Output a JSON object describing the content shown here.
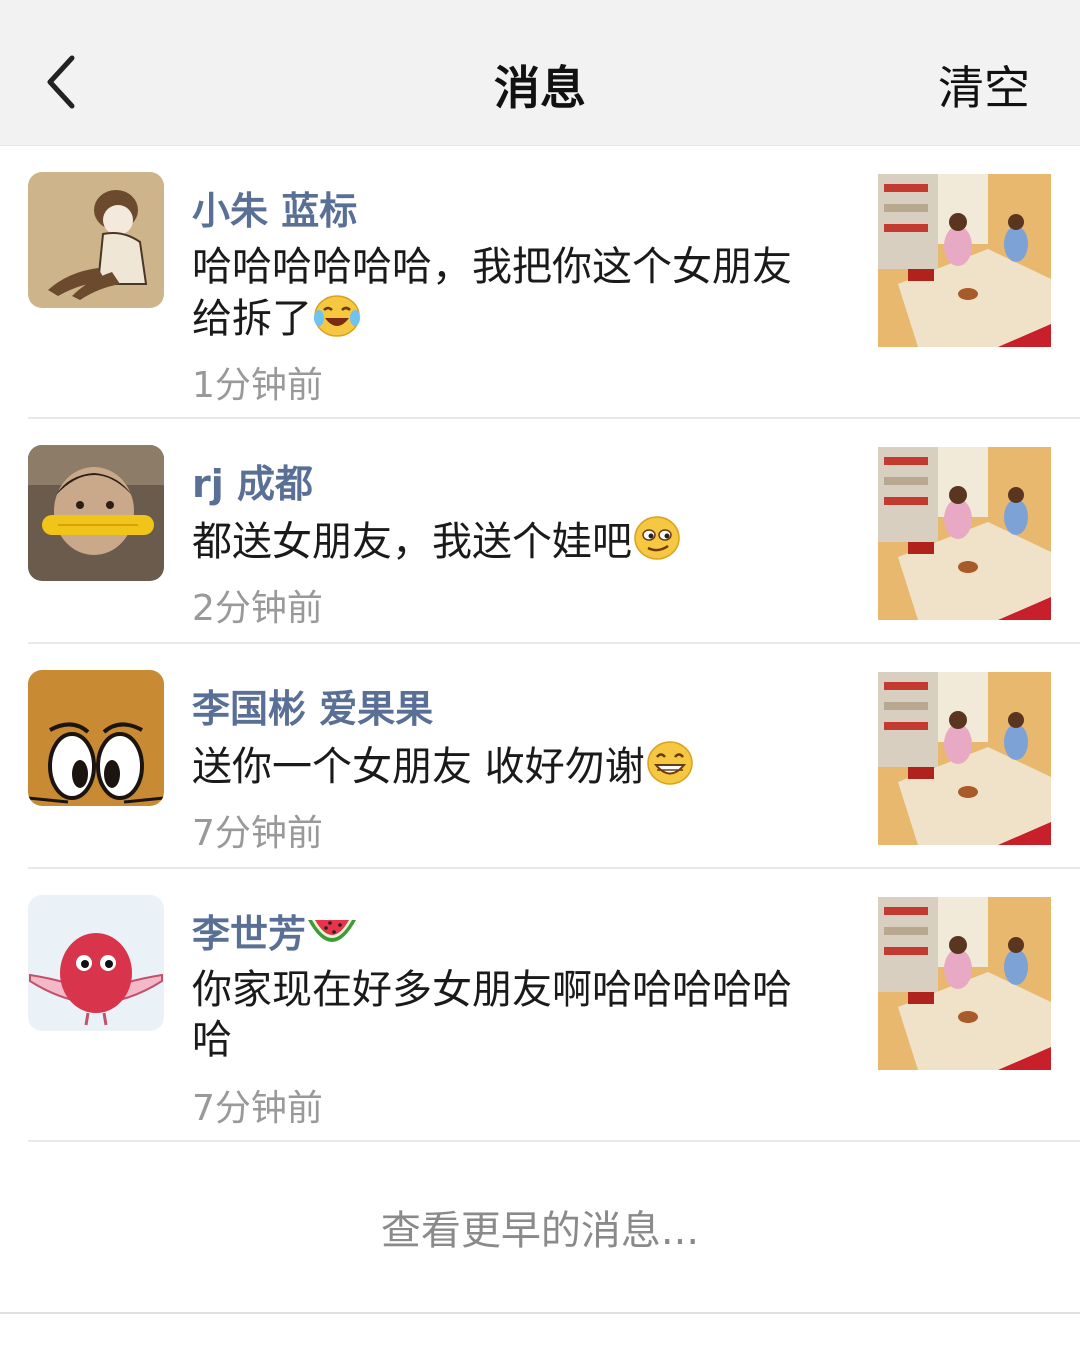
{
  "header": {
    "back_icon": "chevron-left-icon",
    "title": "消息",
    "clear_label": "清空"
  },
  "messages": [
    {
      "name": "小朱 蓝标",
      "text": "哈哈哈哈哈哈，我把你这个女朋友给拆了",
      "text_line1": "哈哈哈哈哈哈，我把你这个女朋友",
      "text_line2": "给拆了",
      "emoji": "laughing-tears-emoji",
      "time": "1分钟前"
    },
    {
      "name": "rj 成都",
      "text": "都送女朋友，我送个娃吧",
      "emoji": "smirk-emoji",
      "time": "2分钟前"
    },
    {
      "name": "李国彬 爱果果",
      "text": "送你一个女朋友 收好勿谢",
      "emoji": "grin-emoji",
      "time": "7分钟前"
    },
    {
      "name": "李世芳",
      "name_emoji": "watermelon-emoji",
      "text": "你家现在好多女朋友啊哈哈哈哈哈哈",
      "text_line1": "你家现在好多女朋友啊哈哈哈哈哈",
      "text_line2": "哈",
      "time": "7分钟前"
    }
  ],
  "load_more_label": "查看更早的消息..."
}
